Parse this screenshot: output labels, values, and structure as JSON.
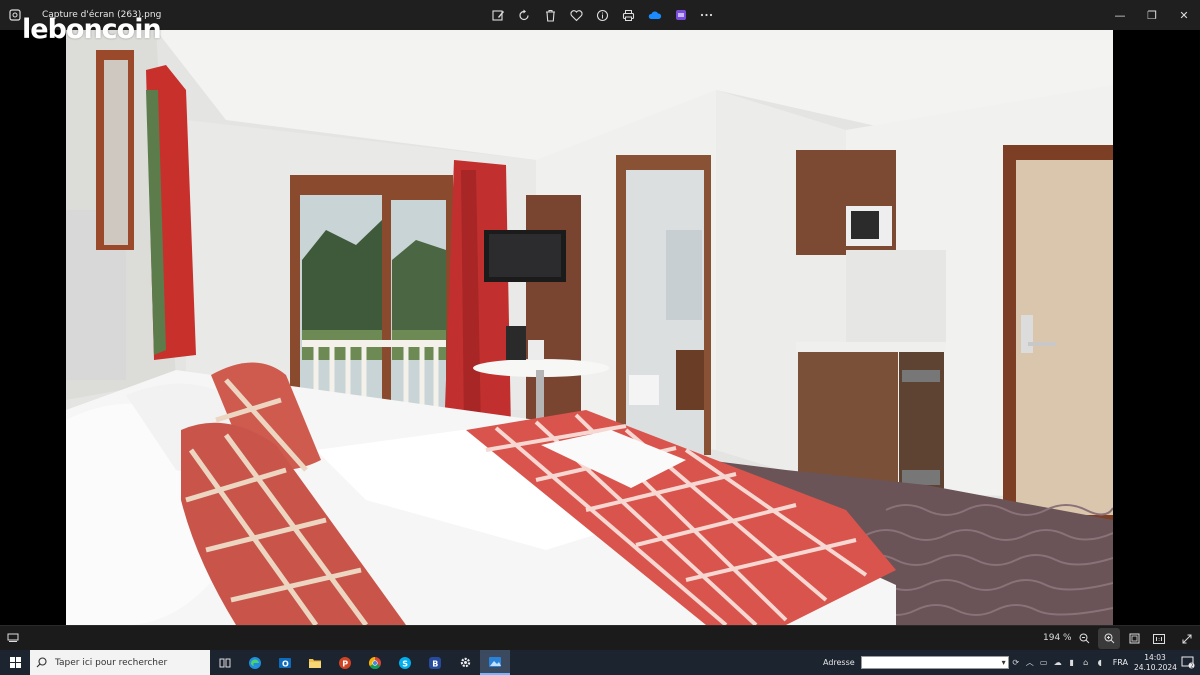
{
  "window": {
    "file_name": "Capture d'écran (263).png",
    "toolbar": [
      "edit-icon",
      "rotate-icon",
      "delete-icon",
      "favorite-icon",
      "info-icon",
      "print-icon",
      "onedrive-icon",
      "clipchamp-icon",
      "more-icon"
    ],
    "controls": {
      "minimize": "—",
      "restore": "❐",
      "close": "✕"
    }
  },
  "watermark": "leboncoin",
  "statusbar": {
    "zoom": "194 %"
  },
  "taskbar": {
    "search_placeholder": "Taper ici pour rechercher",
    "apps": [
      {
        "name": "task-view",
        "label": ""
      },
      {
        "name": "edge",
        "label": ""
      },
      {
        "name": "outlook",
        "label": "O"
      },
      {
        "name": "file-explorer",
        "label": ""
      },
      {
        "name": "powerpoint",
        "label": "P"
      },
      {
        "name": "chrome",
        "label": ""
      },
      {
        "name": "skype",
        "label": "S"
      },
      {
        "name": "bing",
        "label": "B"
      },
      {
        "name": "settings",
        "label": ""
      },
      {
        "name": "photos",
        "label": ""
      }
    ],
    "address_label": "Adresse",
    "language": "FRA",
    "time": "14:03",
    "date": "24.10.2024",
    "notification_count": "2"
  },
  "colors": {
    "titlebar": "#1f1f1f",
    "taskbar": "#1c2430",
    "accent": "#7ab4ff"
  }
}
